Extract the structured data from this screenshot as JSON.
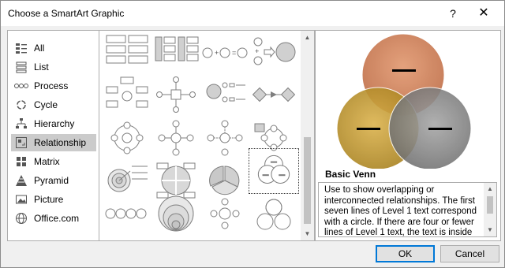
{
  "window": {
    "title": "Choose a SmartArt Graphic",
    "help_glyph": "?",
    "close_glyph": "✕"
  },
  "categories": [
    {
      "label": "All",
      "icon": "all-icon"
    },
    {
      "label": "List",
      "icon": "list-icon"
    },
    {
      "label": "Process",
      "icon": "process-icon"
    },
    {
      "label": "Cycle",
      "icon": "cycle-icon"
    },
    {
      "label": "Hierarchy",
      "icon": "hierarchy-icon"
    },
    {
      "label": "Relationship",
      "icon": "relationship-icon",
      "selected": true
    },
    {
      "label": "Matrix",
      "icon": "matrix-icon"
    },
    {
      "label": "Pyramid",
      "icon": "pyramid-icon"
    },
    {
      "label": "Picture",
      "icon": "picture-icon"
    },
    {
      "label": "Office.com",
      "icon": "office-com-icon"
    }
  ],
  "gallery": {
    "selected_layout": "Basic Venn"
  },
  "preview": {
    "title": "Basic Venn",
    "description": "Use to show overlapping or interconnected relationships. The first seven lines of Level 1 text correspond with a circle. If there are four or fewer lines of Level 1 text, the text is inside",
    "venn_colors": {
      "top": "#d9865d",
      "left": "#c9a03a",
      "right": "#8a8a8a"
    }
  },
  "buttons": {
    "ok": "OK",
    "cancel": "Cancel"
  }
}
